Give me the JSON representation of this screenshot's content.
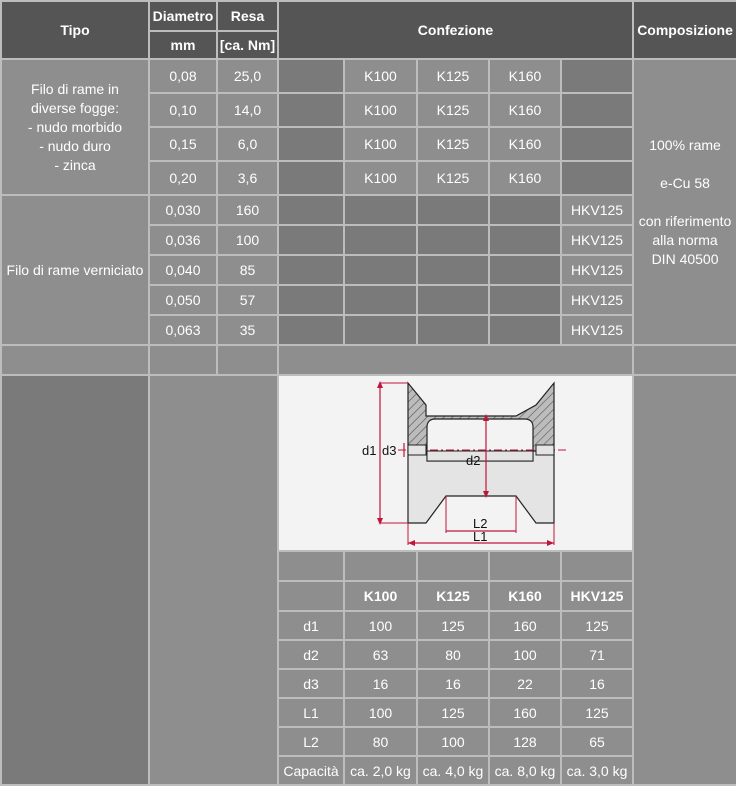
{
  "header": {
    "tipo": "Tipo",
    "diametro": "Diametro",
    "resa": "Resa",
    "confezione": "Confezione",
    "composizione": "Composizione",
    "unit_mm": "mm",
    "unit_resa": "[ca. Nm]"
  },
  "rame": {
    "tipo_lines": [
      "Filo di rame in",
      "diverse fogge:",
      "- nudo morbido",
      "- nudo duro",
      "- zinca"
    ],
    "rows": [
      {
        "diam": "0,08",
        "resa": "25,0",
        "k100": "K100",
        "k125": "K125",
        "k160": "K160"
      },
      {
        "diam": "0,10",
        "resa": "14,0",
        "k100": "K100",
        "k125": "K125",
        "k160": "K160"
      },
      {
        "diam": "0,15",
        "resa": "6,0",
        "k100": "K100",
        "k125": "K125",
        "k160": "K160"
      },
      {
        "diam": "0,20",
        "resa": "3,6",
        "k100": "K100",
        "k125": "K125",
        "k160": "K160"
      }
    ]
  },
  "verniciato": {
    "tipo": "Filo di rame verniciato",
    "rows": [
      {
        "diam": "0,030",
        "resa": "160",
        "hkv": "HKV125"
      },
      {
        "diam": "0,036",
        "resa": "100",
        "hkv": "HKV125"
      },
      {
        "diam": "0,040",
        "resa": "85",
        "hkv": "HKV125"
      },
      {
        "diam": "0,050",
        "resa": "57",
        "hkv": "HKV125"
      },
      {
        "diam": "0,063",
        "resa": "35",
        "hkv": "HKV125"
      }
    ]
  },
  "composizione": {
    "line1": "100% rame",
    "line2": "e-Cu 58",
    "line3": "con riferimento",
    "line4": "alla norma",
    "line5": "DIN 40500"
  },
  "diagram": {
    "d1": "d1",
    "d3": "d3",
    "d2": "d2",
    "l1": "L1",
    "l2": "L2"
  },
  "dims": {
    "headers": [
      "K100",
      "K125",
      "K160",
      "HKV125"
    ],
    "rows": [
      {
        "label": "d1",
        "values": [
          "100",
          "125",
          "160",
          "125"
        ]
      },
      {
        "label": "d2",
        "values": [
          "63",
          "80",
          "100",
          "71"
        ]
      },
      {
        "label": "d3",
        "values": [
          "16",
          "16",
          "22",
          "16"
        ]
      },
      {
        "label": "L1",
        "values": [
          "100",
          "125",
          "160",
          "125"
        ]
      },
      {
        "label": "L2",
        "values": [
          "80",
          "100",
          "128",
          "65"
        ]
      },
      {
        "label": "Capacità",
        "values": [
          "ca. 2,0 kg",
          "ca. 4,0 kg",
          "ca. 8,0 kg",
          "ca. 3,0 kg"
        ]
      }
    ]
  }
}
